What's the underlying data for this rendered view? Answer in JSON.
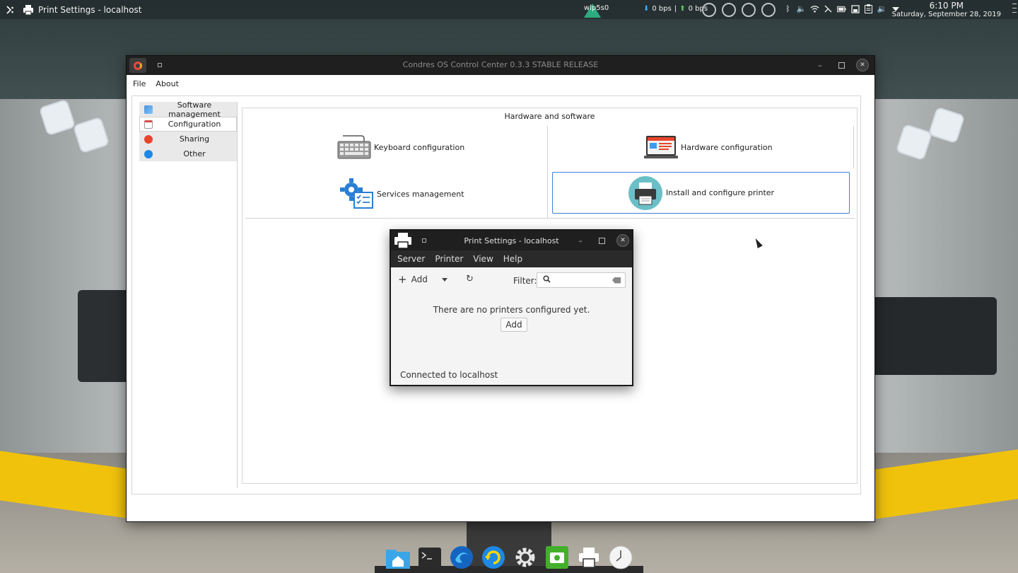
{
  "top_panel": {
    "app_menu_icon": "app-menu-icon",
    "active_window_title": "Print Settings - localhost",
    "network_name": "wlp5s0",
    "download_speed": "0 bps",
    "upload_speed": "0 bps",
    "speed_separator": "|",
    "time": "6:10 PM",
    "date": "Saturday, September 28, 2019"
  },
  "main_window": {
    "title": "Condres OS Control Center 0.3.3 STABLE RELEASE",
    "menu": {
      "file": "File",
      "about": "About"
    },
    "sidebar": {
      "items": [
        {
          "label": "Software management",
          "icon": "software-icon",
          "color": "#4a90d9"
        },
        {
          "label": "Configuration",
          "icon": "configuration-icon",
          "color": "#d94a4a"
        },
        {
          "label": "Sharing",
          "icon": "sharing-icon",
          "color": "#e8452c"
        },
        {
          "label": "Other",
          "icon": "other-icon",
          "color": "#1e88e5"
        }
      ]
    },
    "content": {
      "section_title": "Hardware and software",
      "tiles": {
        "keyboard": "Keyboard configuration",
        "hardware": "Hardware configuration",
        "services": "Services management",
        "printer": "Install and configure printer"
      }
    }
  },
  "print_dialog": {
    "title": "Print Settings - localhost",
    "menu": {
      "server": "Server",
      "printer": "Printer",
      "view": "View",
      "help": "Help"
    },
    "toolbar": {
      "add_label": "Add",
      "filter_label": "Filter:",
      "filter_value": ""
    },
    "message": "There are no printers configured yet.",
    "add_button": "Add",
    "status": "Connected to localhost"
  },
  "colors": {
    "accent": "#3b7fd9",
    "titlebar": "#1f1f1f",
    "dock_indicator": "#3d9cf0"
  }
}
